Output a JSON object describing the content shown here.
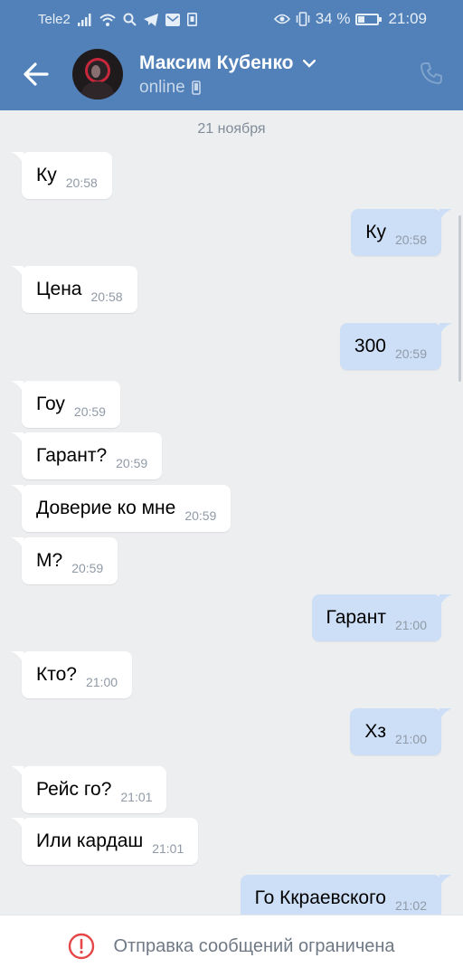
{
  "status_bar": {
    "carrier": "Tele2",
    "battery": "34 %",
    "battery_level": 0.34,
    "time": "21:09"
  },
  "header": {
    "contact_name": "Максим Кубенко",
    "status": "online",
    "icons": [
      "back-arrow-icon",
      "chevron-down-icon",
      "mobile-icon",
      "phone-icon"
    ]
  },
  "chat": {
    "date_separator": "21 ноября",
    "messages": [
      {
        "direction": "in",
        "text": "Ку",
        "time": "20:58"
      },
      {
        "direction": "out",
        "text": "Ку",
        "time": "20:58"
      },
      {
        "direction": "in",
        "text": "Цена",
        "time": "20:58"
      },
      {
        "direction": "out",
        "text": "300",
        "time": "20:59"
      },
      {
        "direction": "in",
        "text": "Гоу",
        "time": "20:59"
      },
      {
        "direction": "in",
        "text": "Гарант?",
        "time": "20:59"
      },
      {
        "direction": "in",
        "text": "Доверие ко мне",
        "time": "20:59"
      },
      {
        "direction": "in",
        "text": "М?",
        "time": "20:59"
      },
      {
        "direction": "out",
        "text": "Гарант",
        "time": "21:00"
      },
      {
        "direction": "in",
        "text": "Кто?",
        "time": "21:00"
      },
      {
        "direction": "out",
        "text": "Хз",
        "time": "21:00"
      },
      {
        "direction": "in",
        "text": "Рейс го?",
        "time": "21:01"
      },
      {
        "direction": "in",
        "text": "Или кардаш",
        "time": "21:01"
      },
      {
        "direction": "out",
        "text": "Го Ккраевского",
        "time": "21:02"
      }
    ]
  },
  "footer": {
    "notice": "Отправка сообщений ограничена",
    "icon": "warning-circle-icon"
  },
  "colors": {
    "header": "#5181b8",
    "background": "#edeef0",
    "incoming": "#ffffff",
    "outgoing": "#cddff6",
    "warning": "#e64646"
  }
}
